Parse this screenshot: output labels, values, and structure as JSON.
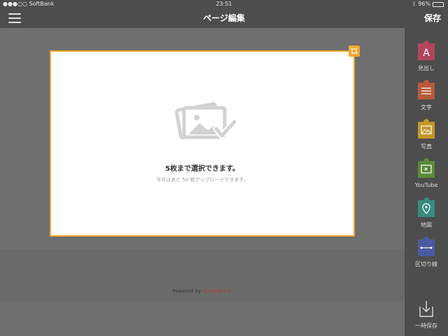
{
  "status_bar": {
    "carrier": "●●●○○ SoftBank",
    "time": "23:51",
    "battery": "96%",
    "battery_level": 0.96
  },
  "nav": {
    "title": "ページ編集",
    "save_label": "保存"
  },
  "modal": {
    "message": "5枚まで選択できます。",
    "sub_message": "今月はあと 50 枚アップロードできます。"
  },
  "footer": {
    "powered_by": "Powered by ",
    "brand": "ロリポタッチ"
  },
  "sidebar": {
    "tools": [
      {
        "label": "見出し",
        "icon": "heading-A-icon",
        "color": "#b2455a"
      },
      {
        "label": "文字",
        "icon": "text-lines-icon",
        "color": "#b65a3a"
      },
      {
        "label": "写真",
        "icon": "photo-icon",
        "color": "#c4962a"
      },
      {
        "label": "YouTube",
        "icon": "video-play-icon",
        "color": "#5a8a3a"
      },
      {
        "label": "地図",
        "icon": "map-pin-icon",
        "color": "#3a8a80"
      },
      {
        "label": "区切り線",
        "icon": "divider-icon",
        "color": "#4a5aa0"
      }
    ],
    "temp_save_label": "一時保存"
  },
  "colors": {
    "accent": "#f0a92c",
    "bar": "#4d4d4d",
    "brand": "#b33a2a"
  }
}
